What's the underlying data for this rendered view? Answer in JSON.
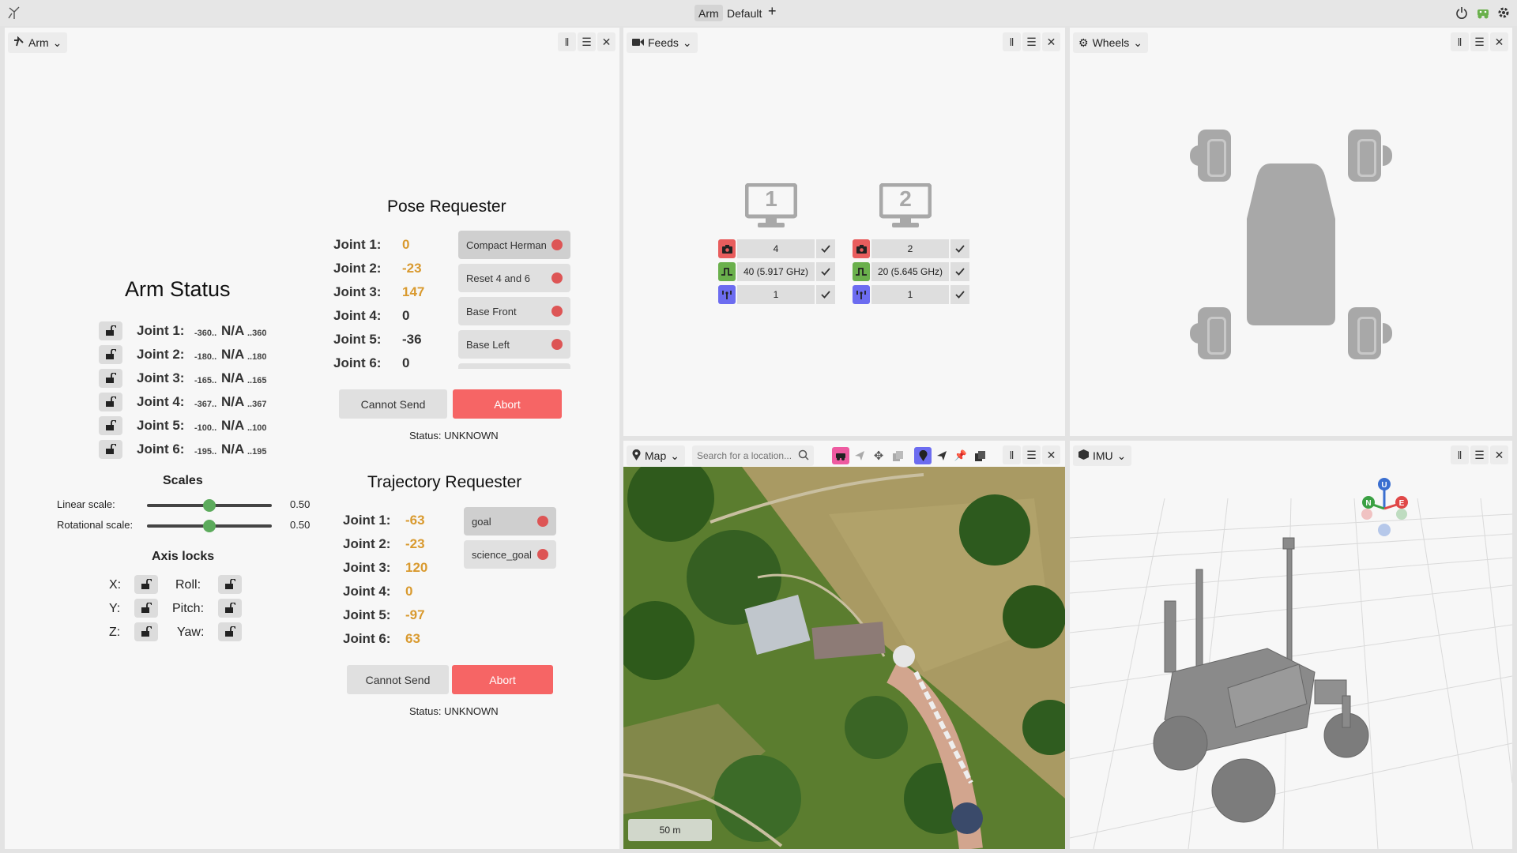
{
  "topbar": {
    "tabs": [
      "Arm",
      "Default"
    ],
    "active_tab": "Arm",
    "add_label": "+"
  },
  "panels": {
    "arm": {
      "title": "Arm"
    },
    "feeds": {
      "title": "Feeds"
    },
    "wheels": {
      "title": "Wheels"
    },
    "map": {
      "title": "Map",
      "search_placeholder": "Search for a location...",
      "scale_label": "50 m"
    },
    "imu": {
      "title": "IMU"
    }
  },
  "arm_status": {
    "title": "Arm Status",
    "joints": [
      {
        "label": "Joint 1:",
        "min": "-360..",
        "value": "N/A",
        "max": "..360"
      },
      {
        "label": "Joint 2:",
        "min": "-180..",
        "value": "N/A",
        "max": "..180"
      },
      {
        "label": "Joint 3:",
        "min": "-165..",
        "value": "N/A",
        "max": "..165"
      },
      {
        "label": "Joint 4:",
        "min": "-367..",
        "value": "N/A",
        "max": "..367"
      },
      {
        "label": "Joint 5:",
        "min": "-100..",
        "value": "N/A",
        "max": "..100"
      },
      {
        "label": "Joint 6:",
        "min": "-195..",
        "value": "N/A",
        "max": "..195"
      }
    ],
    "scales": {
      "title": "Scales",
      "linear_label": "Linear scale:",
      "linear_value": "0.50",
      "linear_fraction": 0.5,
      "rotational_label": "Rotational scale:",
      "rotational_value": "0.50",
      "rotational_fraction": 0.5
    },
    "axis_locks": {
      "title": "Axis locks",
      "x": "X:",
      "y": "Y:",
      "z": "Z:",
      "roll": "Roll:",
      "pitch": "Pitch:",
      "yaw": "Yaw:"
    }
  },
  "pose_requester": {
    "title": "Pose Requester",
    "joints": [
      {
        "label": "Joint 1:",
        "value": "0",
        "color": "#d99a2f"
      },
      {
        "label": "Joint 2:",
        "value": "-23",
        "color": "#d99a2f"
      },
      {
        "label": "Joint 3:",
        "value": "147",
        "color": "#d99a2f"
      },
      {
        "label": "Joint 4:",
        "value": "0",
        "color": "#333333"
      },
      {
        "label": "Joint 5:",
        "value": "-36",
        "color": "#333333"
      },
      {
        "label": "Joint 6:",
        "value": "0",
        "color": "#333333"
      }
    ],
    "presets": [
      "Compact Herman",
      "Reset 4 and 6",
      "Base Front",
      "Base Left"
    ],
    "send_label": "Cannot Send",
    "abort_label": "Abort",
    "status": "Status: UNKNOWN"
  },
  "trajectory_requester": {
    "title": "Trajectory Requester",
    "joints": [
      {
        "label": "Joint 1:",
        "value": "-63"
      },
      {
        "label": "Joint 2:",
        "value": "-23"
      },
      {
        "label": "Joint 3:",
        "value": "120"
      },
      {
        "label": "Joint 4:",
        "value": "0"
      },
      {
        "label": "Joint 5:",
        "value": "-97"
      },
      {
        "label": "Joint 6:",
        "value": "63"
      }
    ],
    "presets": [
      "goal",
      "science_goal"
    ],
    "send_label": "Cannot Send",
    "abort_label": "Abort",
    "status": "Status: UNKNOWN"
  },
  "feeds": [
    {
      "monitor": "1",
      "camera": "4",
      "frequency": "40 (5.917 GHz)",
      "antenna": "1"
    },
    {
      "monitor": "2",
      "camera": "2",
      "frequency": "20 (5.645 GHz)",
      "antenna": "1"
    }
  ],
  "imu": {
    "axes": [
      "U",
      "N",
      "E"
    ]
  },
  "colors": {
    "abort": "#f66565",
    "accent_orange": "#d99a2f",
    "camera": "#e85d5d",
    "frequency": "#6ab04c",
    "antenna": "#6c6cf0",
    "map_tool_pink": "#ee5aa0",
    "map_tool_blue": "#6c6cf0"
  }
}
